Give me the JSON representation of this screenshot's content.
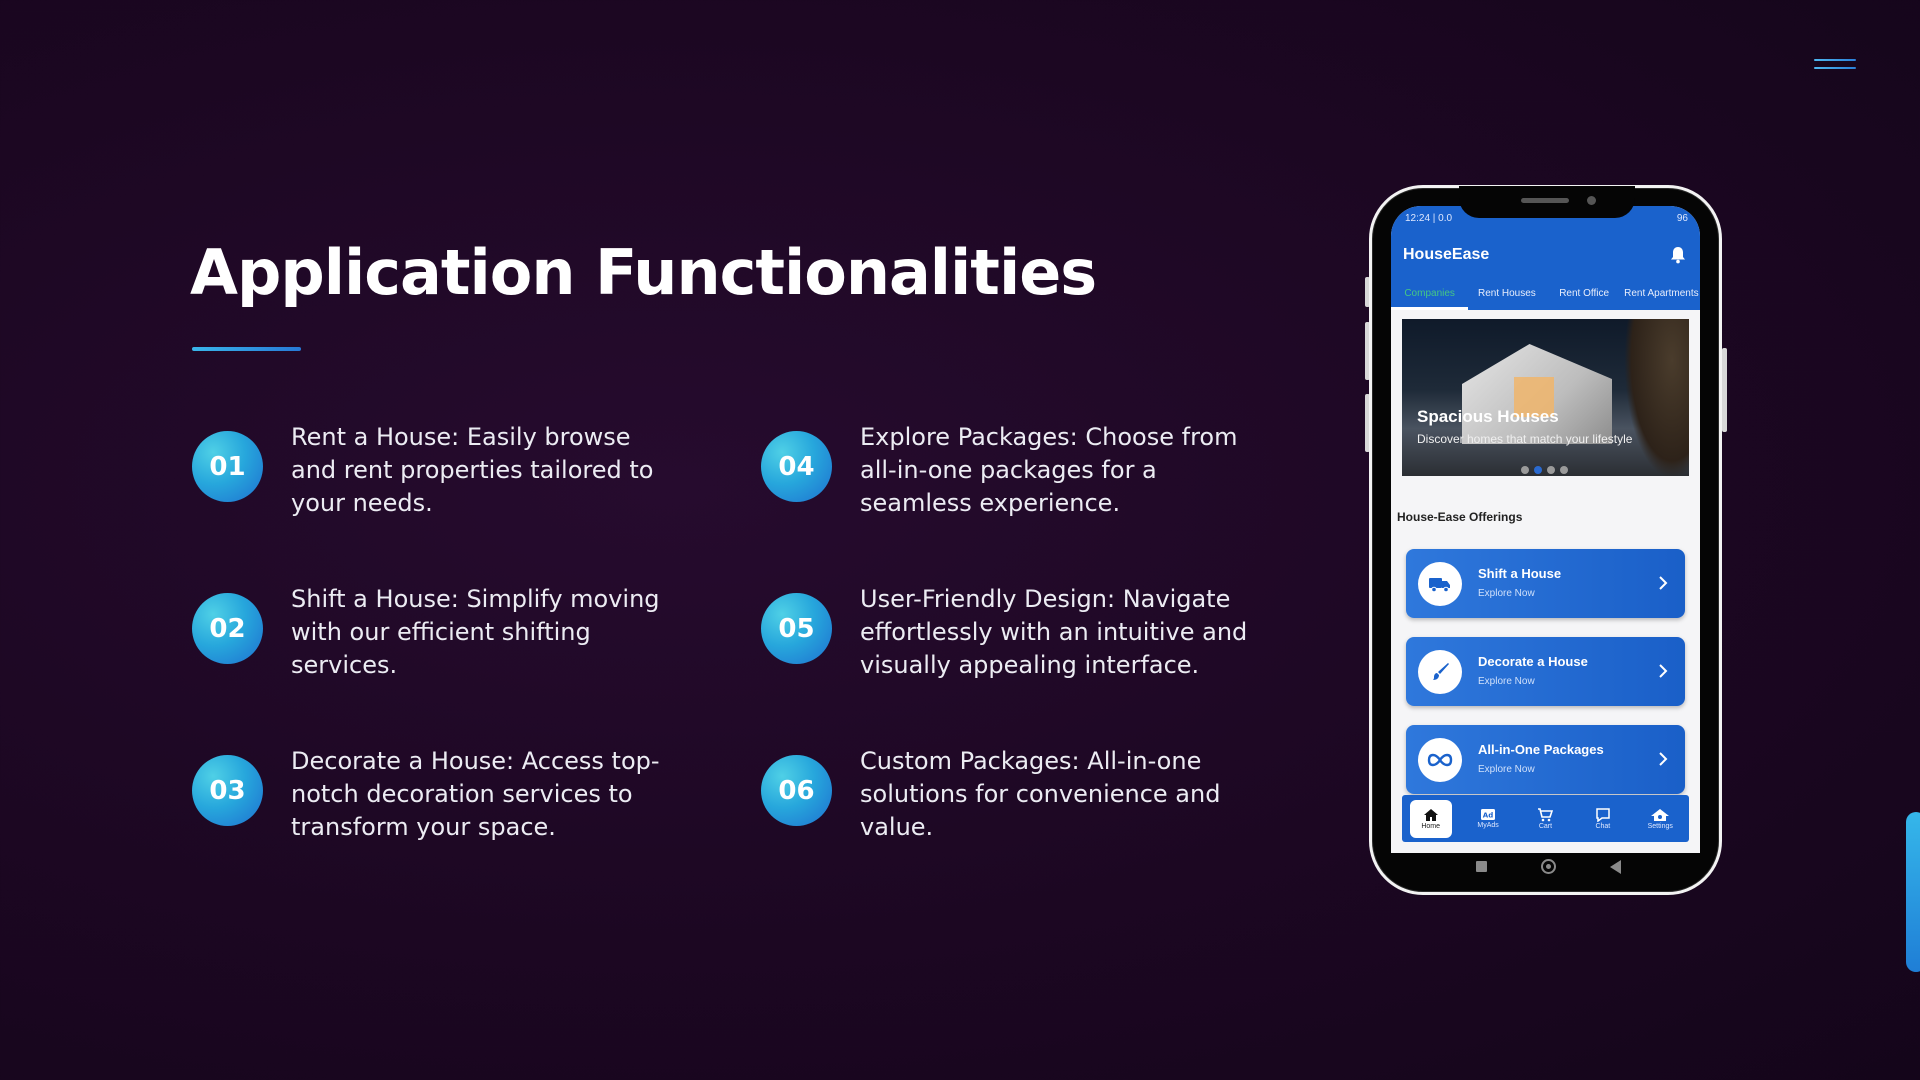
{
  "slide": {
    "title": "Application Functionalities",
    "features": [
      {
        "number": "01",
        "text": "Rent a House: Easily browse and rent properties tailored to your needs."
      },
      {
        "number": "02",
        "text": "Shift a House: Simplify moving with our efficient shifting services."
      },
      {
        "number": "03",
        "text": "Decorate a House: Access top-notch decoration services to transform your space."
      },
      {
        "number": "04",
        "text": "Explore Packages: Choose from all-in-one packages for a seamless experience."
      },
      {
        "number": "05",
        "text": "User-Friendly Design: Navigate effortlessly with an intuitive and visually appealing interface."
      },
      {
        "number": "06",
        "text": "Custom Packages: All-in-one solutions for convenience and value."
      }
    ]
  },
  "phone": {
    "status_time": "12:24 | 0.0",
    "status_battery": "96",
    "app_title": "HouseEase",
    "tabs": [
      "Companies",
      "Rent Houses",
      "Rent Office",
      "Rent Apartments"
    ],
    "banner": {
      "title": "Spacious Houses",
      "subtitle": "Discover homes that match your lifestyle",
      "active_dot": 1,
      "dot_count": 4
    },
    "offerings_heading": "House-Ease Offerings",
    "offerings": [
      {
        "title": "Shift a House",
        "subtitle": "Explore Now",
        "icon": "truck-icon"
      },
      {
        "title": "Decorate a House",
        "subtitle": "Explore Now",
        "icon": "paintbrush-icon"
      },
      {
        "title": "All-in-One Packages",
        "subtitle": "Explore Now",
        "icon": "infinity-icon"
      }
    ],
    "bottom_nav": [
      {
        "label": "Home",
        "icon": "home-icon",
        "active": true
      },
      {
        "label": "MyAds",
        "icon": "ads-icon",
        "active": false
      },
      {
        "label": "Cart",
        "icon": "cart-icon",
        "active": false
      },
      {
        "label": "Chat",
        "icon": "chat-icon",
        "active": false
      },
      {
        "label": "Settings",
        "icon": "settings-icon",
        "active": false
      }
    ]
  },
  "colors": {
    "background": "#1c0722",
    "accent": "#2a7fd8",
    "badge_light": "#4fd0e6",
    "app_blue": "#1a62cc",
    "active_tab": "#45c784"
  }
}
